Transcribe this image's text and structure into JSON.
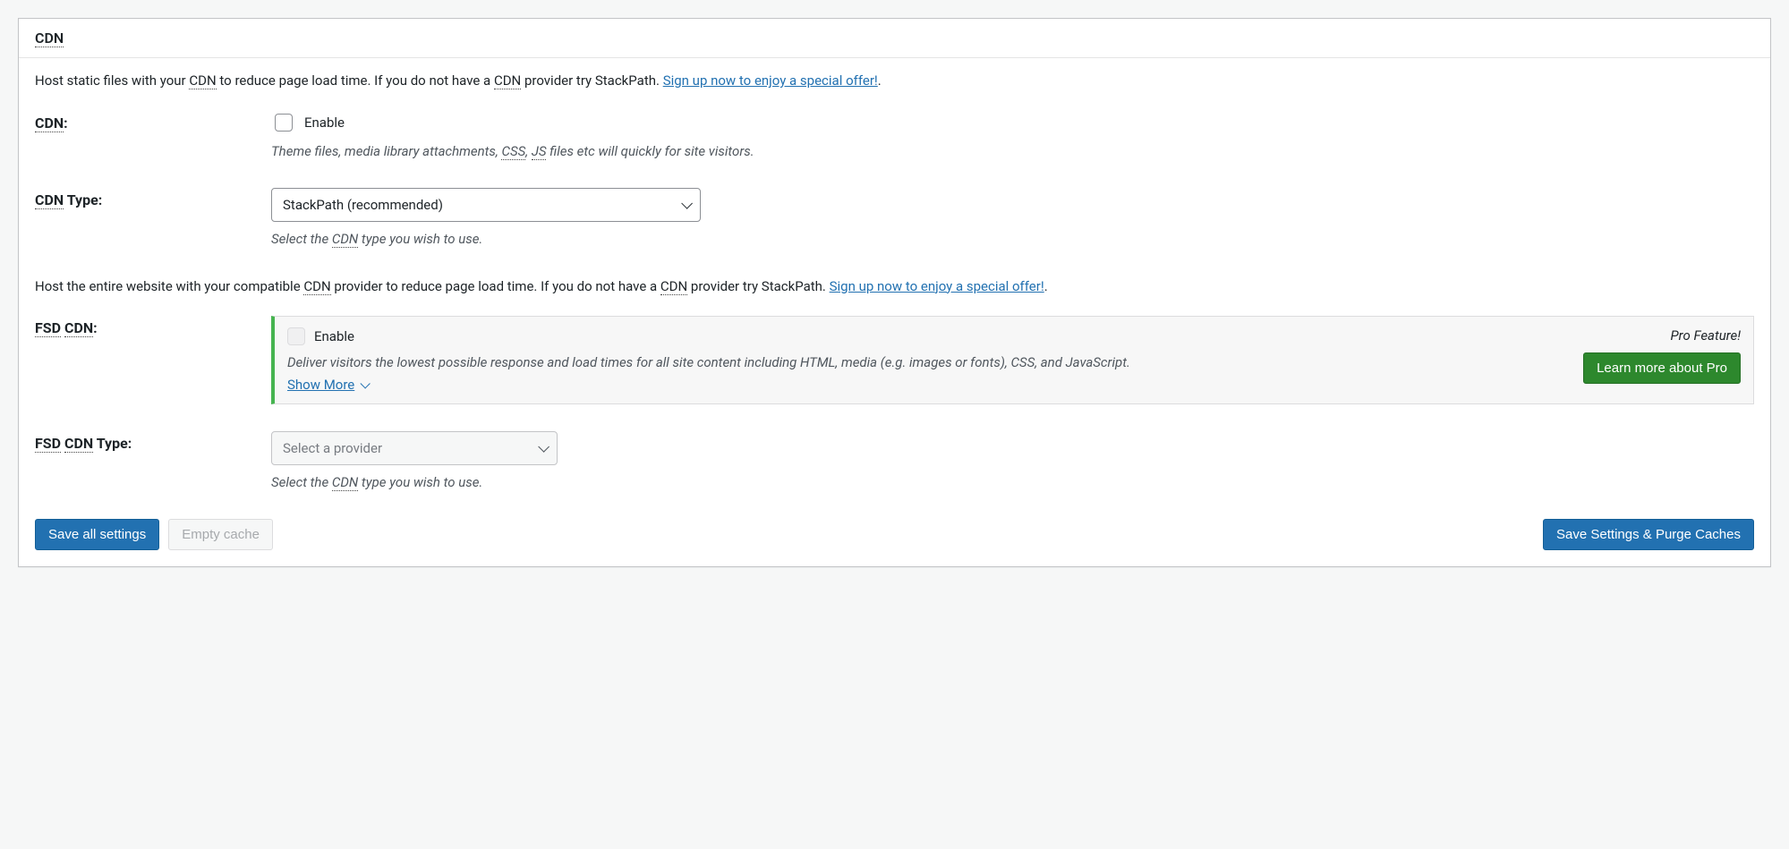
{
  "header": {
    "title": "CDN"
  },
  "intro1": {
    "t1": "Host static files with your ",
    "abbr1": "CDN",
    "t2": " to reduce page load time. If you do not have a ",
    "abbr2": "CDN",
    "t3": " provider try StackPath. ",
    "link": "Sign up now to enjoy a special offer!",
    "t4": "."
  },
  "field_cdn": {
    "label_abbr": "CDN",
    "label_suffix": ":",
    "checkbox_label": "Enable",
    "desc_t1": "Theme files, media library attachments, ",
    "desc_abbr1": "CSS",
    "desc_t2": ", ",
    "desc_abbr2": "JS",
    "desc_t3": " files etc will quickly for site visitors."
  },
  "field_cdn_type": {
    "label_abbr": "CDN",
    "label_suffix": " Type:",
    "selected": "StackPath (recommended)",
    "desc_t1": "Select the ",
    "desc_abbr": "CDN",
    "desc_t2": " type you wish to use."
  },
  "intro2": {
    "t1": "Host the entire website with your compatible ",
    "abbr1": "CDN",
    "t2": " provider to reduce page load time. If you do not have a ",
    "abbr2": "CDN",
    "t3": " provider try StackPath. ",
    "link": "Sign up now to enjoy a special offer!",
    "t4": "."
  },
  "field_fsd": {
    "label_abbr1": "FSD",
    "label_space": " ",
    "label_abbr2": "CDN",
    "label_suffix": ":",
    "checkbox_label": "Enable",
    "desc": "Deliver visitors the lowest possible response and load times for all site content including HTML, media (e.g. images or fonts), CSS, and JavaScript.",
    "show_more": "Show More",
    "pro_feature": "Pro Feature!",
    "learn_more": "Learn more about Pro"
  },
  "field_fsd_type": {
    "label_abbr1": "FSD",
    "label_space": " ",
    "label_abbr2": "CDN",
    "label_suffix": " Type:",
    "placeholder": "Select a provider",
    "desc_t1": "Select the ",
    "desc_abbr": "CDN",
    "desc_t2": " type you wish to use."
  },
  "footer": {
    "save_all": "Save all settings",
    "empty_cache": "Empty cache",
    "save_purge": "Save Settings & Purge Caches"
  }
}
